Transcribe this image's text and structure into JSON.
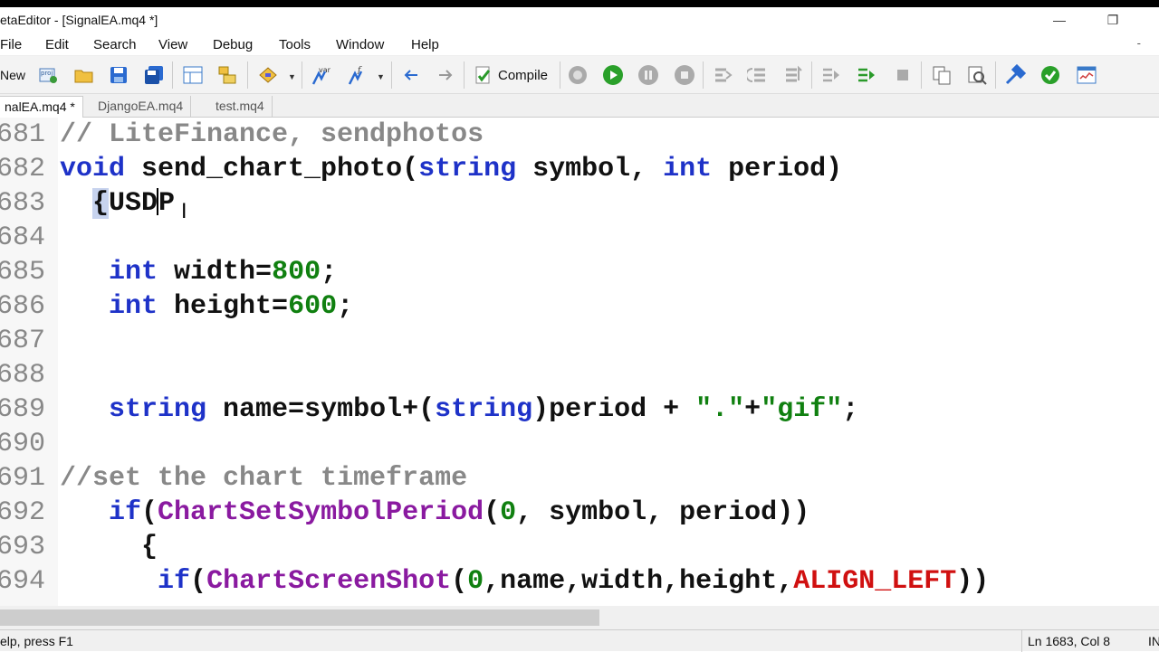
{
  "window": {
    "title": "etaEditor - [SignalEA.mq4 *]",
    "minimize": "—",
    "restore": "❐"
  },
  "menu": {
    "items": [
      "File",
      "Edit",
      "Search",
      "View",
      "Debug",
      "Tools",
      "Window",
      "Help"
    ],
    "doc_restore": "-"
  },
  "toolbar": {
    "new_label": "New",
    "compile_label": "Compile",
    "icons": [
      "new-project-icon",
      "open-folder-icon",
      "save-icon",
      "save-all-icon",
      "navigator-icon",
      "toolbox-icon",
      "styler-icon",
      "variable-icon",
      "function-icon",
      "back-arrow-icon",
      "forward-arrow-icon",
      "compile-icon",
      "start-profiling-icon",
      "start-debug-icon",
      "pause-icon",
      "stop-icon",
      "step-into-icon",
      "step-over-icon",
      "step-out-icon",
      "add-watch-icon",
      "continue-icon",
      "stop-debug-icon",
      "copy-icon",
      "find-icon",
      "settings-icon",
      "check-icon",
      "terminal-icon"
    ]
  },
  "tabs": [
    {
      "label": "nalEA.mq4 *",
      "active": true
    },
    {
      "label": "DjangoEA.mq4",
      "active": false
    },
    {
      "label": "test.mq4",
      "active": false
    }
  ],
  "code_lines": [
    {
      "num": "681",
      "parts": [
        {
          "t": "// LiteFinance, sendphotos",
          "c": "cmt"
        }
      ]
    },
    {
      "num": "682",
      "parts": [
        {
          "t": "void",
          "c": "kw"
        },
        {
          "t": " send_chart_photo(",
          "c": ""
        },
        {
          "t": "string",
          "c": "kw"
        },
        {
          "t": " symbol, ",
          "c": ""
        },
        {
          "t": "int",
          "c": "kw"
        },
        {
          "t": " period)",
          "c": ""
        }
      ]
    },
    {
      "num": "683",
      "parts": [
        {
          "t": "  ",
          "c": ""
        },
        {
          "t": "{",
          "c": "sel"
        },
        {
          "t": "USD",
          "c": ""
        },
        {
          "t": "",
          "c": "caret"
        },
        {
          "t": "P",
          "c": ""
        }
      ]
    },
    {
      "num": "684",
      "parts": []
    },
    {
      "num": "685",
      "parts": [
        {
          "t": "   ",
          "c": ""
        },
        {
          "t": "int",
          "c": "kw"
        },
        {
          "t": " width=",
          "c": ""
        },
        {
          "t": "800",
          "c": "num"
        },
        {
          "t": ";",
          "c": ""
        }
      ]
    },
    {
      "num": "686",
      "parts": [
        {
          "t": "   ",
          "c": ""
        },
        {
          "t": "int",
          "c": "kw"
        },
        {
          "t": " height=",
          "c": ""
        },
        {
          "t": "600",
          "c": "num"
        },
        {
          "t": ";",
          "c": ""
        }
      ]
    },
    {
      "num": "687",
      "parts": []
    },
    {
      "num": "688",
      "parts": []
    },
    {
      "num": "689",
      "parts": [
        {
          "t": "   ",
          "c": ""
        },
        {
          "t": "string",
          "c": "kw"
        },
        {
          "t": " name=symbol+(",
          "c": ""
        },
        {
          "t": "string",
          "c": "kw"
        },
        {
          "t": ")period + ",
          "c": ""
        },
        {
          "t": "\".\"",
          "c": "str"
        },
        {
          "t": "+",
          "c": ""
        },
        {
          "t": "\"gif\"",
          "c": "str"
        },
        {
          "t": ";",
          "c": ""
        }
      ]
    },
    {
      "num": "690",
      "parts": []
    },
    {
      "num": "691",
      "parts": [
        {
          "t": "//set the chart timeframe",
          "c": "cmt"
        }
      ]
    },
    {
      "num": "692",
      "parts": [
        {
          "t": "   ",
          "c": ""
        },
        {
          "t": "if",
          "c": "kw"
        },
        {
          "t": "(",
          "c": ""
        },
        {
          "t": "ChartSetSymbolPeriod",
          "c": "fn"
        },
        {
          "t": "(",
          "c": ""
        },
        {
          "t": "0",
          "c": "num"
        },
        {
          "t": ", symbol, period))",
          "c": ""
        }
      ]
    },
    {
      "num": "693",
      "parts": [
        {
          "t": "     {",
          "c": ""
        }
      ]
    },
    {
      "num": "694",
      "parts": [
        {
          "t": "      ",
          "c": ""
        },
        {
          "t": "if",
          "c": "kw"
        },
        {
          "t": "(",
          "c": ""
        },
        {
          "t": "ChartScreenShot",
          "c": "fn"
        },
        {
          "t": "(",
          "c": ""
        },
        {
          "t": "0",
          "c": "num"
        },
        {
          "t": ",name,width,height,",
          "c": ""
        },
        {
          "t": "ALIGN_LEFT",
          "c": "const"
        },
        {
          "t": "))",
          "c": ""
        }
      ]
    }
  ],
  "status": {
    "help": "elp, press F1",
    "position": "Ln 1683, Col 8",
    "mode": "IN"
  },
  "colors": {
    "keyword": "#1e32c8",
    "number": "#108010",
    "comment": "#888888",
    "function": "#8a1aa0",
    "constant": "#d01010"
  }
}
